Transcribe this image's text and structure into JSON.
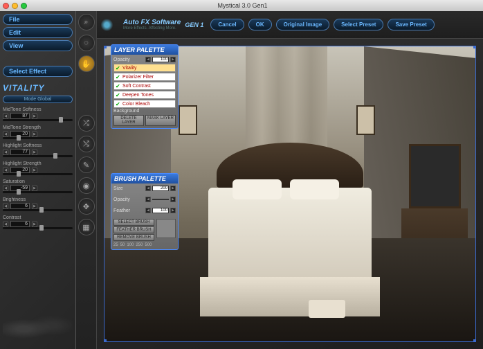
{
  "window": {
    "title": "Mystical 3.0 Gen1"
  },
  "menu": {
    "file": "File",
    "edit": "Edit",
    "view": "View",
    "select_effect": "Select Effect"
  },
  "branding": {
    "name": "Auto FX Software",
    "tagline": "More Effects. Affecting More.",
    "gen": "GEN 1"
  },
  "top_buttons": {
    "cancel": "Cancel",
    "ok": "OK",
    "original": "Original Image",
    "select_preset": "Select Preset",
    "save_preset": "Save Preset"
  },
  "effect": {
    "name": "VITALITY",
    "mode": "Mode Global",
    "sliders": [
      {
        "label": "MidTone Softness",
        "value": "87"
      },
      {
        "label": "MidTone Strength",
        "value": "20"
      },
      {
        "label": "Highlight Softness",
        "value": "77"
      },
      {
        "label": "Highlight Strength",
        "value": "20"
      },
      {
        "label": "Saturation",
        "value": "-59"
      },
      {
        "label": "Brightness",
        "value": "6"
      },
      {
        "label": "Contrast",
        "value": "6"
      }
    ]
  },
  "layer_palette": {
    "title": "LAYER PALETTE",
    "opacity_label": "Opacity",
    "opacity_value": "100",
    "layers": [
      {
        "name": "Vitality",
        "selected": true
      },
      {
        "name": "Polarizer Filter",
        "selected": false
      },
      {
        "name": "Soft Contrast",
        "selected": false
      },
      {
        "name": "Deepen Tones",
        "selected": false
      },
      {
        "name": "Color Bleach",
        "selected": false
      }
    ],
    "background_label": "Background",
    "btn_delete": "DELETE LAYER",
    "btn_mask": "MASK LAYER"
  },
  "brush_palette": {
    "title": "BRUSH PALETTE",
    "size_label": "Size",
    "size_value": "200",
    "opacity_label": "Opacity",
    "opacity_value": "",
    "feather_label": "Feather",
    "feather_value": "100",
    "btn_select": "SELECT BRUSH",
    "btn_feather": "FEATHER BRUSH",
    "btn_remove": "REMOVE BRUSH",
    "sizes": [
      "25",
      "50",
      "100",
      "250",
      "500"
    ]
  }
}
